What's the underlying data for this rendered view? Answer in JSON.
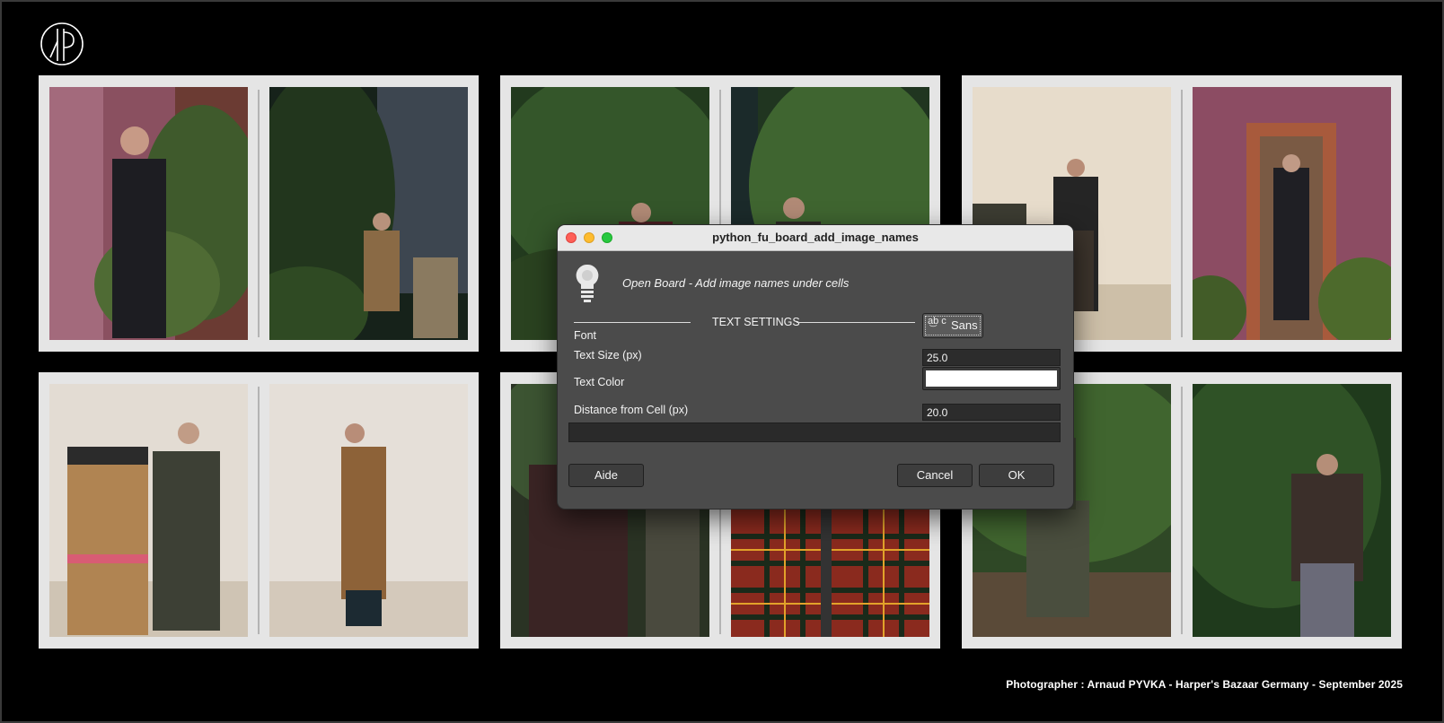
{
  "credit": "Photographer : Arnaud PYVKA - Harper's Bazaar Germany - September 2025",
  "logo_icon": "ap-monogram-logo",
  "dialog": {
    "title": "python_fu_board_add_image_names",
    "icon": "lightbulb-icon",
    "description": "Open Board - Add image names under cells",
    "section_title": "TEXT SETTINGS",
    "fields": {
      "font_label": "Font",
      "font_glyph": "a͜b c",
      "font_value": "Sans",
      "size_label": "Text Size (px)",
      "size_value": "25.0",
      "color_label": "Text Color",
      "color_value": "#ffffff",
      "distance_label": "Distance from Cell (px)",
      "distance_value": "20.0"
    },
    "buttons": {
      "help": "Aide",
      "cancel": "Cancel",
      "ok": "OK"
    }
  },
  "colors": {
    "background": "#000000",
    "card": "#e5e5e5",
    "dialog_bg": "#4b4b4b",
    "titlebar": "#e8e8e8"
  }
}
